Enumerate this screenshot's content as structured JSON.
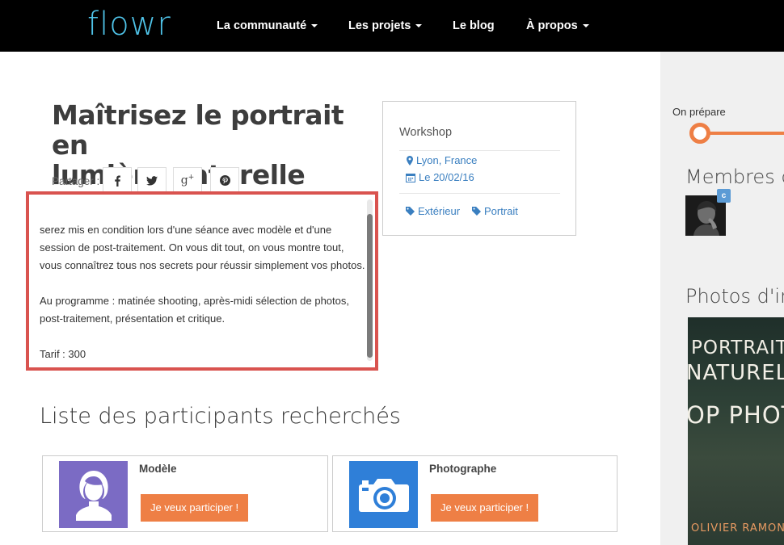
{
  "header": {
    "logo": "flowr",
    "nav": [
      {
        "label": "La communauté",
        "dropdown": true
      },
      {
        "label": "Les projets",
        "dropdown": true
      },
      {
        "label": "Le blog",
        "dropdown": false
      },
      {
        "label": "À propos",
        "dropdown": true
      }
    ]
  },
  "project": {
    "title_line1": "Maîtrisez le portrait en",
    "title_line2": "lumière naturelle",
    "share_label": "Partager :",
    "share_buttons": [
      "facebook-icon",
      "twitter-icon",
      "google-plus-icon",
      "pinterest-icon"
    ],
    "description": {
      "paragraph1_line1": "serez mis en condition lors d'une séance avec modèle et d'une",
      "paragraph1_line2": "session de post-traitement. On vous dit tout, on vous montre tout,",
      "paragraph1_line3": "vous connaîtrez tous nos secrets pour réussir simplement vos photos.",
      "paragraph2_line1": "Au programme : matinée shooting, après-midi sélection de photos,",
      "paragraph2_line2": "post-traitement, présentation et critique.",
      "paragraph3_partial": "Tarif : 300"
    }
  },
  "info_card": {
    "type": "Workshop",
    "location": "Lyon, France",
    "date": "Le 20/02/16",
    "tags": [
      "Extérieur",
      "Portrait"
    ]
  },
  "participants": {
    "heading": "Liste des participants recherchés",
    "roles": [
      {
        "name": "Modèle",
        "button": "Je veux participer !",
        "icon": "person-icon",
        "color": "#7b6bc4"
      },
      {
        "name": "Photographe",
        "button": "Je veux participer !",
        "icon": "camera-icon",
        "color": "#2f7fd8"
      }
    ]
  },
  "sidebar": {
    "progress_label": "On prépare",
    "members_heading": "Membres du projet",
    "member_badge": "c",
    "photos_heading": "Photos d'inspiration",
    "poster": {
      "line1": "PORTRAIT EN",
      "line2": "NATURELLE",
      "line3": "OP PHOTO",
      "credit": "OLIVIER RAMONTEU"
    }
  },
  "colors": {
    "accent": "#ee7f45",
    "link": "#3a7fc0",
    "highlight_border": "#d9534f",
    "nav_bg": "#000000"
  }
}
